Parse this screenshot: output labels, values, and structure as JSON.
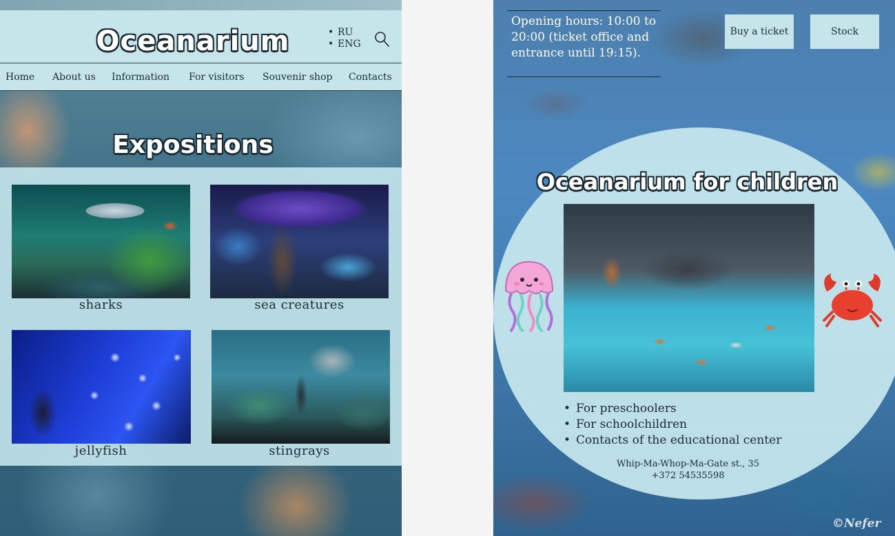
{
  "left": {
    "logo": "Oceanarium",
    "languages": [
      "RU",
      "ENG"
    ],
    "nav": [
      "Home",
      "About us",
      "Information",
      "For visitors",
      "Souvenir shop",
      "Contacts"
    ],
    "expositions_title": "Expositions",
    "expositions": [
      {
        "label": "sharks"
      },
      {
        "label": "sea creatures"
      },
      {
        "label": "jellyfish"
      },
      {
        "label": "stingrays"
      }
    ]
  },
  "right": {
    "opening_hours": "Opening hours: 10:00 to 20:00 (ticket office and entrance until 19:15).",
    "buttons": {
      "buy_ticket": "Buy a ticket",
      "stock": "Stock"
    },
    "children_title": "Oceanarium for children",
    "children_list": [
      "For preschoolers",
      "For schoolchildren",
      "Contacts of the educational center"
    ],
    "address_line1": "Whip-Ma-Whop-Ma-Gate st., 35",
    "address_line2": "+372 54535598",
    "watermark": "©Nefer"
  }
}
